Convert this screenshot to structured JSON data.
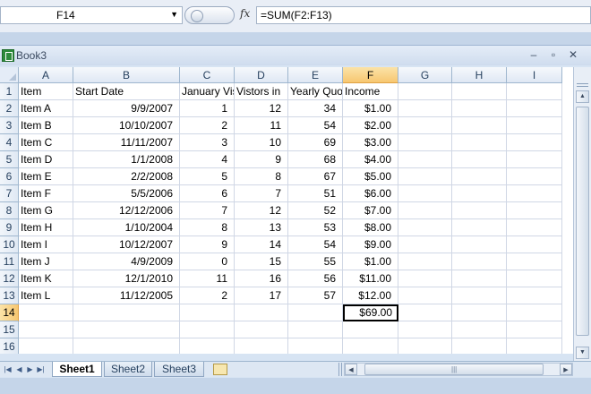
{
  "formula_bar": {
    "name_box": "F14",
    "fx_symbol": "fx",
    "formula": "=SUM(F2:F13)"
  },
  "workbook": {
    "title": "Book3",
    "controls": {
      "minimize": "–",
      "restore": "▫",
      "close": "✕"
    }
  },
  "grid": {
    "columns": [
      "A",
      "B",
      "C",
      "D",
      "E",
      "F",
      "G",
      "H",
      "I"
    ],
    "row_numbers": [
      "1",
      "2",
      "3",
      "4",
      "5",
      "6",
      "7",
      "8",
      "9",
      "10",
      "11",
      "12",
      "13",
      "14",
      "15",
      "16"
    ],
    "headers": [
      "Item",
      "Start Date",
      "January Visitors",
      "Vistors in",
      "Yearly Quota",
      "Income"
    ],
    "rows": [
      [
        "Item A",
        "9/9/2007",
        "1",
        "12",
        "34",
        "$1.00"
      ],
      [
        "Item B",
        "10/10/2007",
        "2",
        "11",
        "54",
        "$2.00"
      ],
      [
        "Item C",
        "11/11/2007",
        "3",
        "10",
        "69",
        "$3.00"
      ],
      [
        "Item D",
        "1/1/2008",
        "4",
        "9",
        "68",
        "$4.00"
      ],
      [
        "Item E",
        "2/2/2008",
        "5",
        "8",
        "67",
        "$5.00"
      ],
      [
        "Item F",
        "5/5/2006",
        "6",
        "7",
        "51",
        "$6.00"
      ],
      [
        "Item G",
        "12/12/2006",
        "7",
        "12",
        "52",
        "$7.00"
      ],
      [
        "Item H",
        "1/10/2004",
        "8",
        "13",
        "53",
        "$8.00"
      ],
      [
        "Item I",
        "10/12/2007",
        "9",
        "14",
        "54",
        "$9.00"
      ],
      [
        "Item J",
        "4/9/2009",
        "0",
        "15",
        "55",
        "$1.00"
      ],
      [
        "Item K",
        "12/1/2010",
        "11",
        "16",
        "56",
        "$11.00"
      ],
      [
        "Item L",
        "11/12/2005",
        "2",
        "17",
        "57",
        "$12.00"
      ]
    ],
    "total": "$69.00",
    "selected_column": "F",
    "selected_row": "14"
  },
  "sheets": [
    "Sheet1",
    "Sheet2",
    "Sheet3"
  ],
  "active_sheet": "Sheet1",
  "colors": {
    "selection": "#f7c770",
    "gridline": "#d0d7e5",
    "header": "#dfe8f4"
  }
}
